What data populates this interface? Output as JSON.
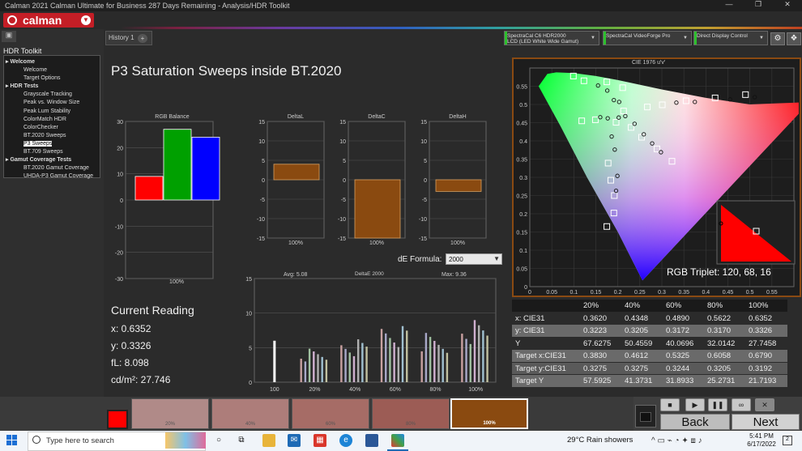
{
  "window": {
    "title": "Calman 2021 Calman Ultimate for Business 287 Days Remaining  - Analysis/HDR Toolkit",
    "controls": [
      "—",
      "❐",
      "✕"
    ]
  },
  "logo": {
    "text": "calman"
  },
  "sidebar": {
    "title": "HDR Toolkit",
    "tree": [
      {
        "label": "Welcome",
        "group": true
      },
      {
        "label": "Welcome",
        "group": false
      },
      {
        "label": "Target Options",
        "group": false
      },
      {
        "label": "HDR Tests",
        "group": true
      },
      {
        "label": "Grayscale Tracking",
        "group": false
      },
      {
        "label": "Peak vs. Window Size",
        "group": false
      },
      {
        "label": "Peak Lum Stability",
        "group": false
      },
      {
        "label": "ColorMatch HDR",
        "group": false
      },
      {
        "label": "ColorChecker",
        "group": false
      },
      {
        "label": "BT.2020 Sweeps",
        "group": false
      },
      {
        "label": "P3 Sweeps",
        "group": false,
        "selected": true
      },
      {
        "label": "BT.709 Sweeps",
        "group": false
      },
      {
        "label": "Gamut Coverage Tests",
        "group": true
      },
      {
        "label": "BT.2020 Gamut Coverage",
        "group": false
      },
      {
        "label": "UHDA-P3 Gamut Coverage",
        "group": false
      }
    ]
  },
  "tabs": {
    "history": "History 1",
    "plus": "+"
  },
  "devices": {
    "meter": {
      "line1": "SpectraCal C6 HDR2000",
      "line2": "LCD (LED White Wide Gamut)"
    },
    "pattern": {
      "line1": "SpectraCal VideoForge Pro"
    },
    "display": {
      "line1": "Direct Display Control"
    }
  },
  "page": {
    "title": "P3 Saturation Sweeps inside BT.2020"
  },
  "rgb_balance": {
    "title": "RGB Balance",
    "ticks": [
      "30",
      "20",
      "10",
      "0",
      "-10",
      "-20",
      "-30"
    ],
    "xlabel": "100%"
  },
  "delta_l": {
    "title": "DeltaL",
    "ticks": [
      "15",
      "10",
      "5",
      "0",
      "-5",
      "-10",
      "-15"
    ],
    "xlabel": "100%"
  },
  "delta_c": {
    "title": "DeltaC",
    "ticks": [
      "15",
      "10",
      "5",
      "0",
      "-5",
      "-10",
      "-15"
    ],
    "xlabel": "100%"
  },
  "delta_h": {
    "title": "DeltaH",
    "ticks": [
      "15",
      "10",
      "5",
      "0",
      "-5",
      "-10",
      "-15"
    ],
    "xlabel": "100%"
  },
  "de_formula": {
    "label": "dE Formula:",
    "value": "2000"
  },
  "deltae": {
    "avg": "Avg: 5.08",
    "title": "DeltaE 2000",
    "max": "Max: 9.36",
    "ticks": [
      "15",
      "10",
      "5",
      "0"
    ],
    "xlabels": [
      "100",
      "20%",
      "40%",
      "60%",
      "80%",
      "100%"
    ]
  },
  "current_reading": {
    "title": "Current Reading",
    "x": "x: 0.6352",
    "y": "y: 0.3326",
    "fl": "fL: 8.098",
    "cd": "cd/m²: 27.746"
  },
  "cie": {
    "title": "CIE 1976 u'v'",
    "triplet": "RGB Triplet: 120, 68, 16",
    "yticks": [
      "0.55",
      "0.5",
      "0.45",
      "0.4",
      "0.35",
      "0.3",
      "0.25",
      "0.2",
      "0.15",
      "0.1",
      "0.05",
      "0"
    ],
    "xticks": [
      "0",
      "0.05",
      "0.1",
      "0.15",
      "0.2",
      "0.25",
      "0.3",
      "0.35",
      "0.4",
      "0.45",
      "0.5",
      "0.55"
    ]
  },
  "table": {
    "headers": [
      "",
      "20%",
      "40%",
      "60%",
      "80%",
      "100%"
    ],
    "rows": [
      {
        "label": "x: CIE31",
        "values": [
          "0.3620",
          "0.4348",
          "0.4890",
          "0.5622",
          "0.6352"
        ]
      },
      {
        "label": "y: CIE31",
        "values": [
          "0.3223",
          "0.3205",
          "0.3172",
          "0.3170",
          "0.3326"
        ]
      },
      {
        "label": "Y",
        "values": [
          "67.6275",
          "50.4559",
          "40.0696",
          "32.0142",
          "27.7458"
        ]
      },
      {
        "label": "Target x:CIE31",
        "values": [
          "0.3830",
          "0.4612",
          "0.5325",
          "0.6058",
          "0.6790"
        ]
      },
      {
        "label": "Target y:CIE31",
        "values": [
          "0.3275",
          "0.3275",
          "0.3244",
          "0.3205",
          "0.3192"
        ]
      },
      {
        "label": "Target Y",
        "values": [
          "57.5925",
          "41.3731",
          "31.8933",
          "25.2731",
          "21.7193"
        ]
      }
    ]
  },
  "swatches": [
    {
      "label": "",
      "color": "#ff0000"
    },
    {
      "label": "20%",
      "color": "#b08a88"
    },
    {
      "label": "40%",
      "color": "#ad7d7a"
    },
    {
      "label": "60%",
      "color": "#a66c66"
    },
    {
      "label": "80%",
      "color": "#9c5c55"
    },
    {
      "label": "100%",
      "color": "#8a4a10"
    }
  ],
  "nav": {
    "back": "Back",
    "next": "Next"
  },
  "taskbar": {
    "search_placeholder": "Type here to search",
    "weather": "29°C  Rain showers",
    "time": "5:41 PM",
    "date": "6/17/2022"
  },
  "colors": {
    "brand": "#c41e26",
    "frame": "#8a4a12",
    "bar_brown": "#8a4a10"
  },
  "chart_data": [
    {
      "type": "bar",
      "title": "RGB Balance",
      "categories": [
        "100%"
      ],
      "series": [
        {
          "name": "R",
          "values": [
            9
          ]
        },
        {
          "name": "G",
          "values": [
            27
          ]
        },
        {
          "name": "B",
          "values": [
            24
          ]
        }
      ],
      "ylim": [
        -30,
        30
      ]
    },
    {
      "type": "bar",
      "title": "DeltaL",
      "categories": [
        "100%"
      ],
      "values": [
        4
      ],
      "ylim": [
        -15,
        15
      ]
    },
    {
      "type": "bar",
      "title": "DeltaC",
      "categories": [
        "100%"
      ],
      "values": [
        -15
      ],
      "ylim": [
        -15,
        15
      ]
    },
    {
      "type": "bar",
      "title": "DeltaH",
      "categories": [
        "100%"
      ],
      "values": [
        -3
      ],
      "ylim": [
        -15,
        15
      ]
    },
    {
      "type": "bar",
      "title": "DeltaE 2000",
      "categories": [
        "100",
        "20%",
        "40%",
        "60%",
        "80%",
        "100%"
      ],
      "values": [
        6.0,
        5.0,
        6.6,
        8.2,
        7.2,
        9.36
      ],
      "ylim": [
        0,
        15
      ]
    },
    {
      "type": "scatter",
      "title": "CIE 1976 u'v'",
      "xlim": [
        0,
        0.6
      ],
      "ylim": [
        0,
        0.6
      ],
      "targets": [
        [
          0.099,
          0.578
        ],
        [
          0.123,
          0.565
        ],
        [
          0.175,
          0.562
        ],
        [
          0.211,
          0.546
        ],
        [
          0.118,
          0.455
        ],
        [
          0.149,
          0.458
        ],
        [
          0.196,
          0.451
        ],
        [
          0.267,
          0.493
        ],
        [
          0.301,
          0.499
        ],
        [
          0.355,
          0.51
        ],
        [
          0.421,
          0.518
        ],
        [
          0.49,
          0.527
        ],
        [
          0.213,
          0.482
        ],
        [
          0.23,
          0.437
        ],
        [
          0.254,
          0.41
        ],
        [
          0.289,
          0.378
        ],
        [
          0.323,
          0.344
        ],
        [
          0.178,
          0.339
        ],
        [
          0.184,
          0.292
        ],
        [
          0.192,
          0.25
        ],
        [
          0.191,
          0.202
        ],
        [
          0.175,
          0.165
        ]
      ],
      "measured": [
        [
          0.155,
          0.552
        ],
        [
          0.176,
          0.538
        ],
        [
          0.191,
          0.512
        ],
        [
          0.203,
          0.507
        ],
        [
          0.16,
          0.465
        ],
        [
          0.177,
          0.462
        ],
        [
          0.202,
          0.464
        ],
        [
          0.333,
          0.505
        ],
        [
          0.375,
          0.507
        ],
        [
          0.455,
          0.514
        ],
        [
          0.511,
          0.52
        ],
        [
          0.217,
          0.468
        ],
        [
          0.238,
          0.447
        ],
        [
          0.259,
          0.418
        ],
        [
          0.278,
          0.393
        ],
        [
          0.298,
          0.369
        ],
        [
          0.186,
          0.412
        ],
        [
          0.193,
          0.376
        ],
        [
          0.199,
          0.304
        ],
        [
          0.196,
          0.263
        ]
      ]
    }
  ]
}
